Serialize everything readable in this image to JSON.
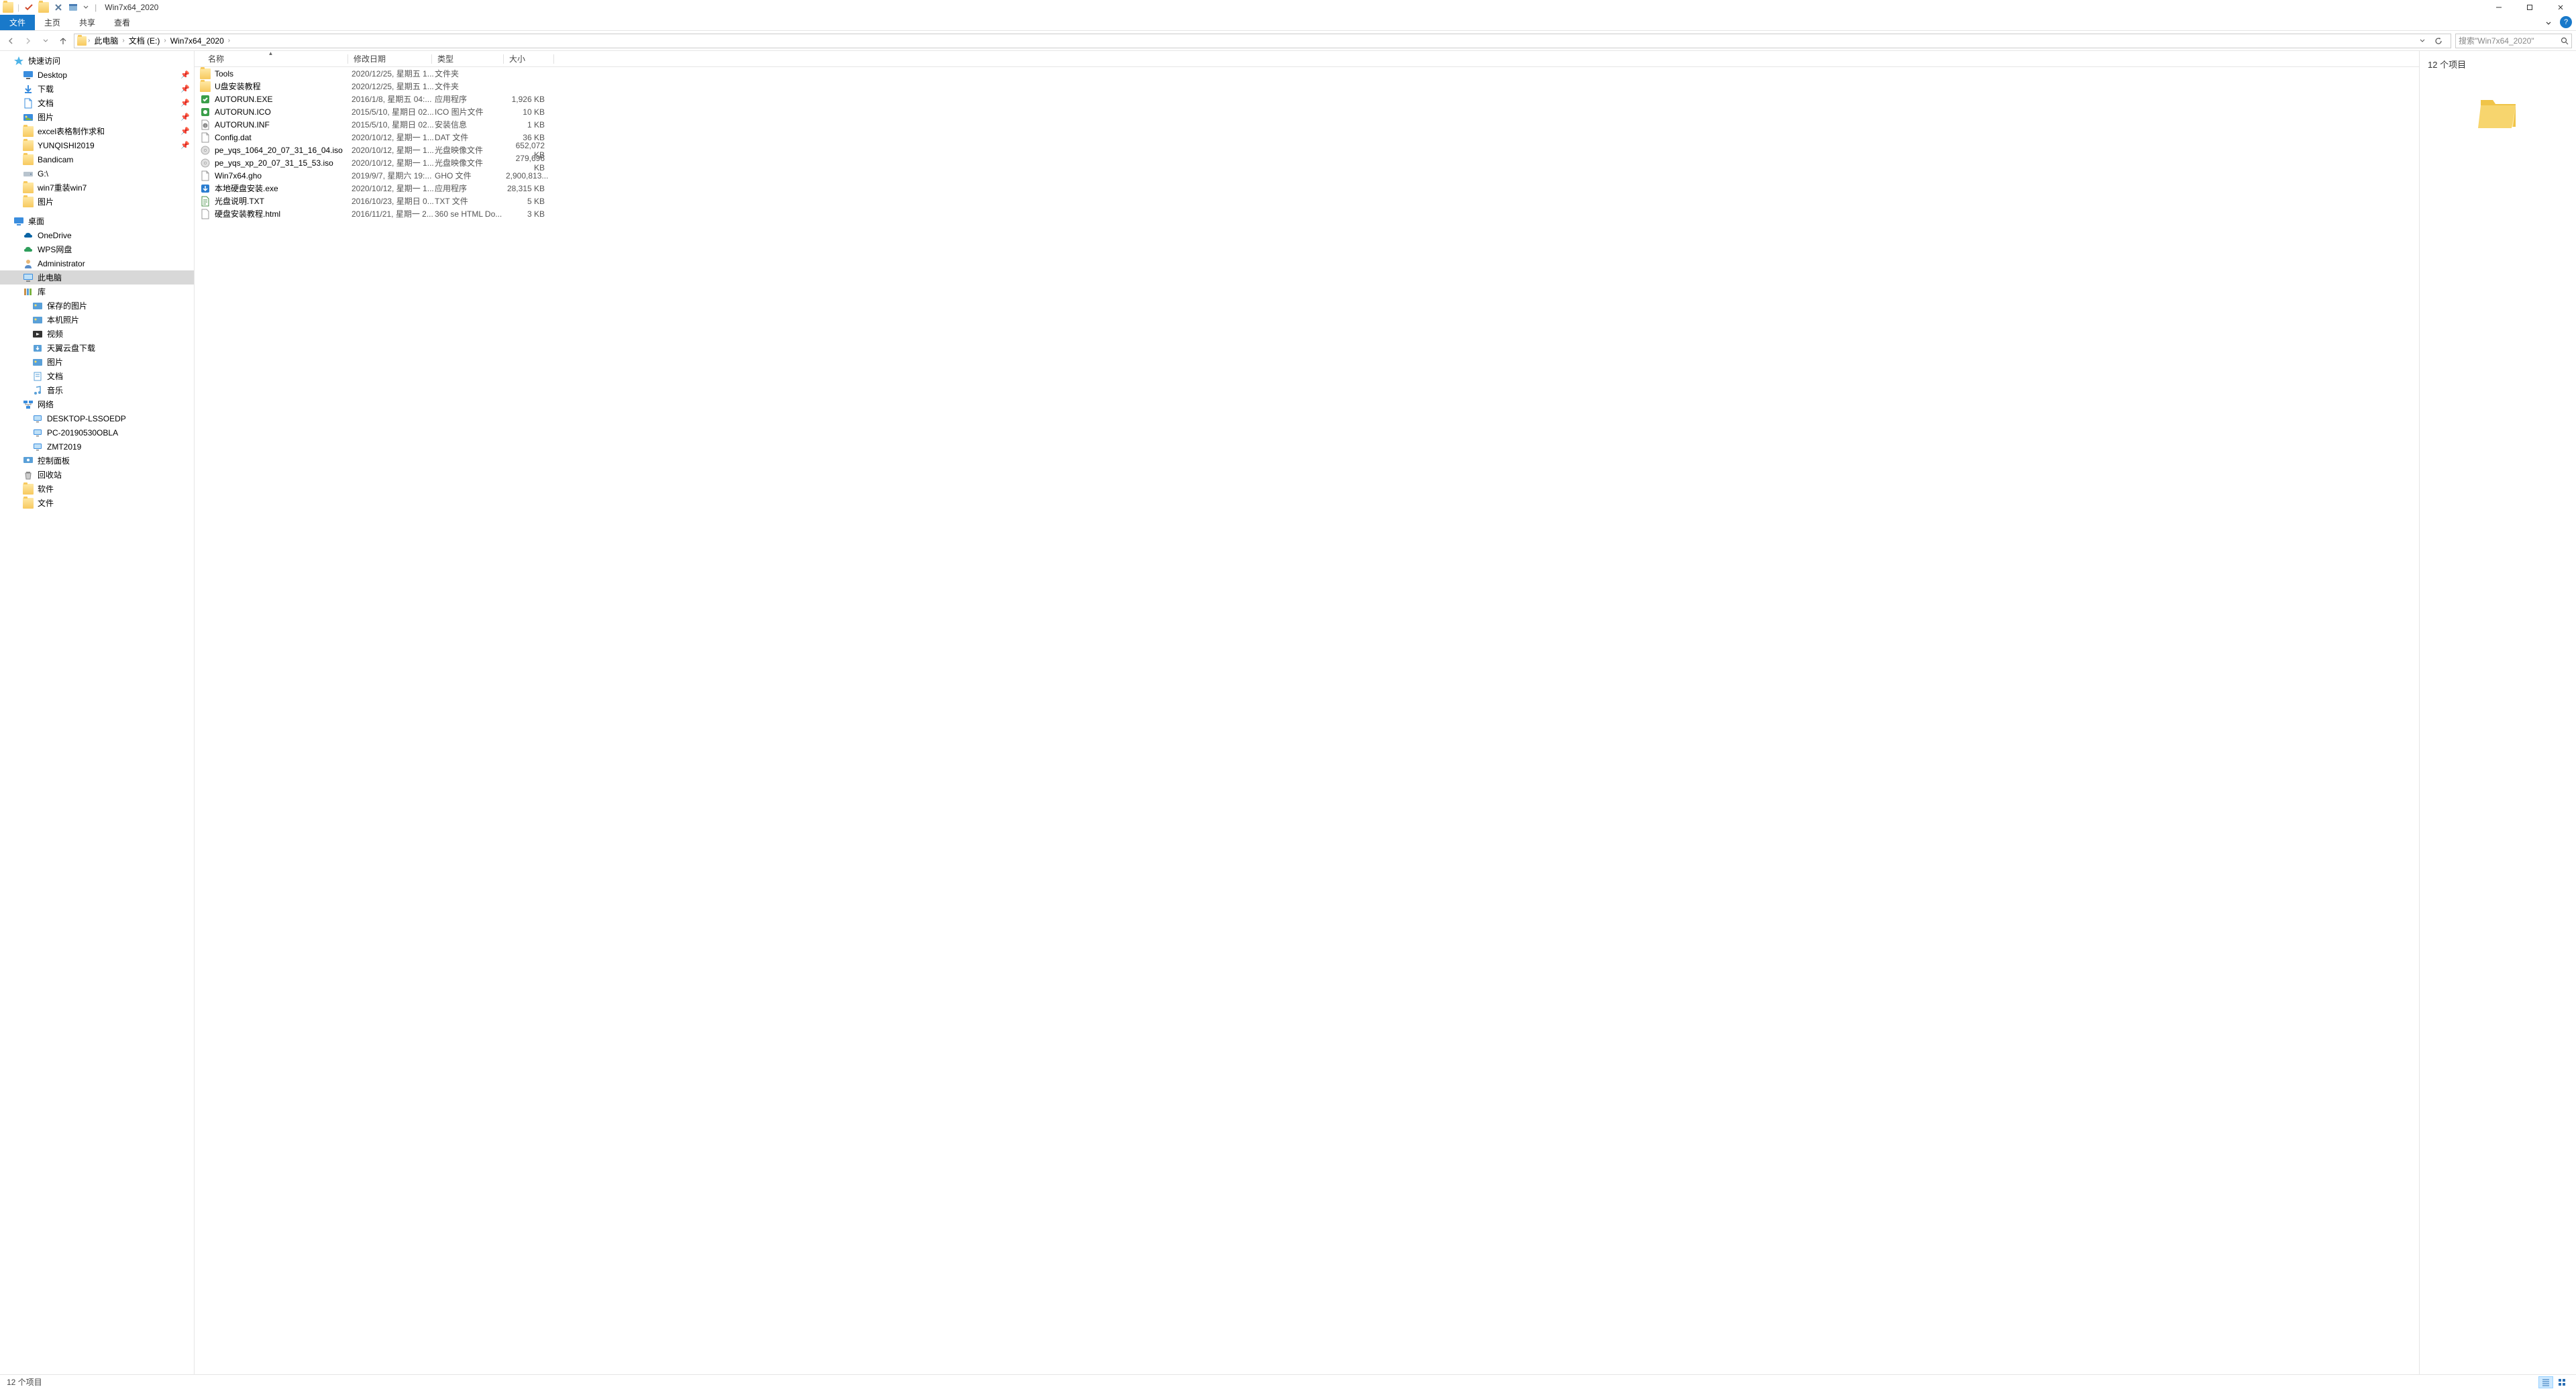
{
  "window": {
    "title": "Win7x64_2020"
  },
  "ribbon": {
    "file": "文件",
    "tabs": [
      "主页",
      "共享",
      "查看"
    ]
  },
  "breadcrumbs": [
    "此电脑",
    "文档 (E:)",
    "Win7x64_2020"
  ],
  "search": {
    "placeholder": "搜索\"Win7x64_2020\""
  },
  "nav": {
    "quick": {
      "label": "快速访问",
      "items": [
        {
          "label": "Desktop",
          "icon": "desktop",
          "pinned": true
        },
        {
          "label": "下载",
          "icon": "downloads",
          "pinned": true
        },
        {
          "label": "文档",
          "icon": "documents",
          "pinned": true
        },
        {
          "label": "图片",
          "icon": "pictures",
          "pinned": true
        },
        {
          "label": "excel表格制作求和",
          "icon": "folder",
          "pinned": true
        },
        {
          "label": "YUNQISHI2019",
          "icon": "folder",
          "pinned": true
        },
        {
          "label": "Bandicam",
          "icon": "folder"
        },
        {
          "label": "G:\\",
          "icon": "drive"
        },
        {
          "label": "win7重装win7",
          "icon": "folder"
        },
        {
          "label": "图片",
          "icon": "folder"
        }
      ]
    },
    "desktopSection": {
      "label": "桌面",
      "items": [
        {
          "label": "OneDrive",
          "icon": "onedrive"
        },
        {
          "label": "WPS网盘",
          "icon": "wps"
        },
        {
          "label": "Administrator",
          "icon": "user"
        },
        {
          "label": "此电脑",
          "icon": "thispc",
          "selected": true
        },
        {
          "label": "库",
          "icon": "libraries"
        },
        {
          "label": "保存的图片",
          "icon": "lib-pic",
          "indent": 1
        },
        {
          "label": "本机照片",
          "icon": "lib-pic",
          "indent": 1
        },
        {
          "label": "视频",
          "icon": "lib-vid",
          "indent": 1
        },
        {
          "label": "天翼云盘下载",
          "icon": "lib-dl",
          "indent": 1
        },
        {
          "label": "图片",
          "icon": "lib-pic",
          "indent": 1
        },
        {
          "label": "文档",
          "icon": "lib-doc",
          "indent": 1
        },
        {
          "label": "音乐",
          "icon": "lib-mus",
          "indent": 1
        },
        {
          "label": "网络",
          "icon": "network"
        },
        {
          "label": "DESKTOP-LSSOEDP",
          "icon": "computer",
          "indent": 1
        },
        {
          "label": "PC-20190530OBLA",
          "icon": "computer",
          "indent": 1
        },
        {
          "label": "ZMT2019",
          "icon": "computer",
          "indent": 1
        },
        {
          "label": "控制面板",
          "icon": "cpanel"
        },
        {
          "label": "回收站",
          "icon": "recycle"
        },
        {
          "label": "软件",
          "icon": "folder"
        },
        {
          "label": "文件",
          "icon": "folder"
        }
      ]
    }
  },
  "columns": {
    "name": "名称",
    "date": "修改日期",
    "type": "类型",
    "size": "大小"
  },
  "files": [
    {
      "name": "Tools",
      "date": "2020/12/25, 星期五 1...",
      "type": "文件夹",
      "size": "",
      "icon": "folder"
    },
    {
      "name": "U盘安装教程",
      "date": "2020/12/25, 星期五 1...",
      "type": "文件夹",
      "size": "",
      "icon": "folder"
    },
    {
      "name": "AUTORUN.EXE",
      "date": "2016/1/8, 星期五 04:...",
      "type": "应用程序",
      "size": "1,926 KB",
      "icon": "exe-green"
    },
    {
      "name": "AUTORUN.ICO",
      "date": "2015/5/10, 星期日 02...",
      "type": "ICO 图片文件",
      "size": "10 KB",
      "icon": "ico"
    },
    {
      "name": "AUTORUN.INF",
      "date": "2015/5/10, 星期日 02...",
      "type": "安装信息",
      "size": "1 KB",
      "icon": "inf"
    },
    {
      "name": "Config.dat",
      "date": "2020/10/12, 星期一 1...",
      "type": "DAT 文件",
      "size": "36 KB",
      "icon": "file"
    },
    {
      "name": "pe_yqs_1064_20_07_31_16_04.iso",
      "date": "2020/10/12, 星期一 1...",
      "type": "光盘映像文件",
      "size": "652,072 KB",
      "icon": "iso"
    },
    {
      "name": "pe_yqs_xp_20_07_31_15_53.iso",
      "date": "2020/10/12, 星期一 1...",
      "type": "光盘映像文件",
      "size": "279,696 KB",
      "icon": "iso"
    },
    {
      "name": "Win7x64.gho",
      "date": "2019/9/7, 星期六 19:...",
      "type": "GHO 文件",
      "size": "2,900,813...",
      "icon": "file"
    },
    {
      "name": "本地硬盘安装.exe",
      "date": "2020/10/12, 星期一 1...",
      "type": "应用程序",
      "size": "28,315 KB",
      "icon": "exe-blue"
    },
    {
      "name": "光盘说明.TXT",
      "date": "2016/10/23, 星期日 0...",
      "type": "TXT 文件",
      "size": "5 KB",
      "icon": "txt"
    },
    {
      "name": "硬盘安装教程.html",
      "date": "2016/11/21, 星期一 2...",
      "type": "360 se HTML Do...",
      "size": "3 KB",
      "icon": "html"
    }
  ],
  "preview": {
    "title": "12 个项目"
  },
  "status": {
    "text": "12 个项目"
  }
}
